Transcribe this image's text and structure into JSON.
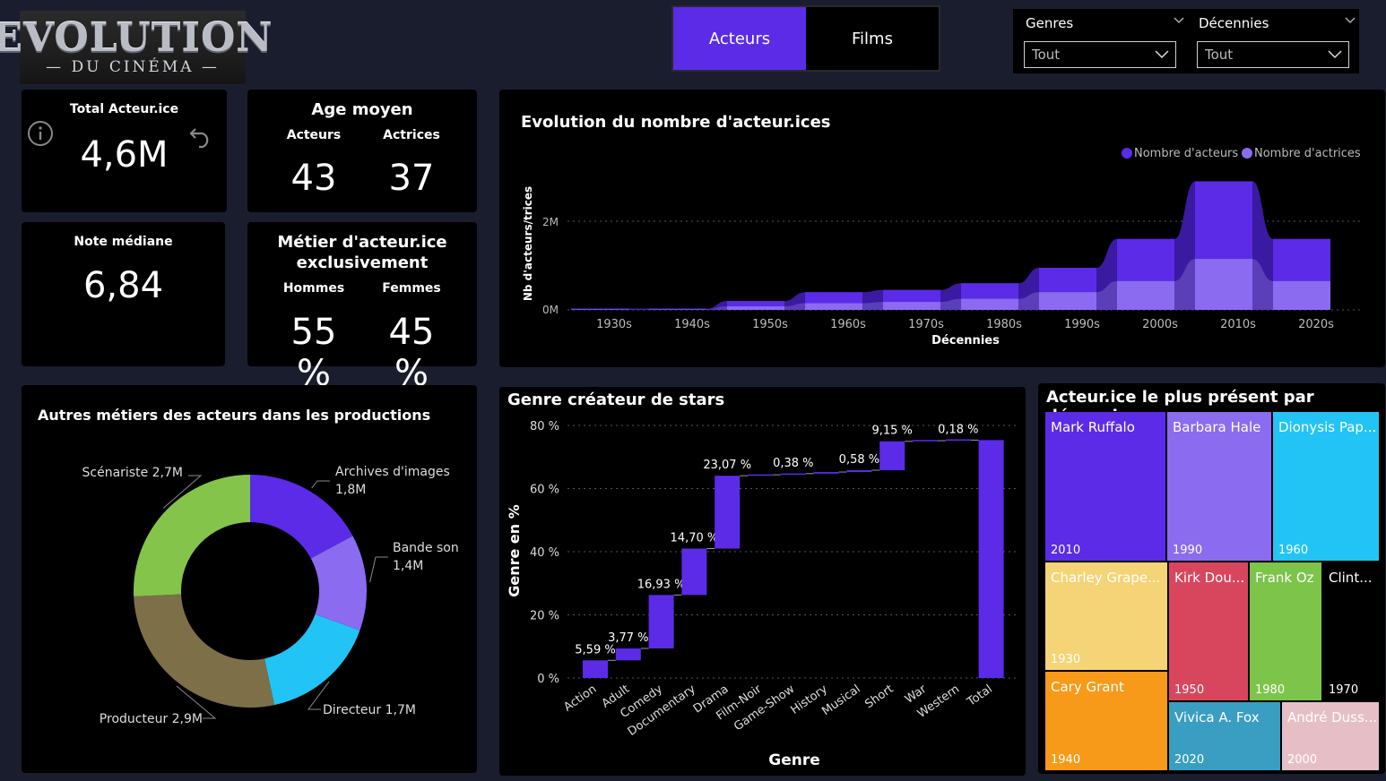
{
  "logo": {
    "main": "EVOLUTION",
    "sub": "— DU CINÉMA —"
  },
  "tabs": [
    {
      "label": "Acteurs",
      "active": true
    },
    {
      "label": "Films",
      "active": false
    }
  ],
  "filters": [
    {
      "label": "Genres",
      "value": "Tout"
    },
    {
      "label": "Décennies",
      "value": "Tout"
    }
  ],
  "kpis": {
    "total": {
      "title": "Total Acteur.ice",
      "value": "4,6M"
    },
    "age": {
      "title": "Age moyen",
      "acteurs_label": "Acteurs",
      "actrices_label": "Actrices",
      "acteurs": "43",
      "actrices": "37"
    },
    "note": {
      "title": "Note médiane",
      "value": "6,84"
    },
    "metier": {
      "title_line1": "Métier d'acteur.ice",
      "title_line2": "exclusivement",
      "hommes_label": "Hommes",
      "femmes_label": "Femmes",
      "hommes": "55 %",
      "femmes": "45 %"
    }
  },
  "colors": {
    "accent": "#5b2be8",
    "accent_light": "#8b6bf0",
    "purple_mid": "#4a22c8"
  },
  "evolution_chart": {
    "title": "Evolution du nombre d'acteur.ices",
    "legend": [
      "Nombre d'acteurs",
      "Nombre d'actrices"
    ],
    "ylabel": "Nb d'acteurs/trices",
    "xlabel": "Décennies",
    "yticks": [
      "2M",
      "0M"
    ]
  },
  "donut_chart": {
    "title": "Autres métiers des acteurs dans les productions"
  },
  "waterfall_chart": {
    "title": "Genre créateur de stars",
    "ylabel": "Genre en %",
    "xlabel": "Genre",
    "yticks": [
      "80 %",
      "60 %",
      "40 %",
      "20 %",
      "0 %"
    ]
  },
  "treemap": {
    "title": "Acteur.ice le plus présent par décennie",
    "cells": [
      {
        "name": "Mark Ruffalo",
        "year": "2010",
        "color": "#5b2be8"
      },
      {
        "name": "Barbara Hale",
        "year": "1990",
        "color": "#8b6bf0"
      },
      {
        "name": "Dionysis Pap...",
        "year": "1960",
        "color": "#22c4f5"
      },
      {
        "name": "Charley Grape...",
        "year": "1930",
        "color": "#f5d477"
      },
      {
        "name": "Kirk Dou...",
        "year": "1950",
        "color": "#d8465e"
      },
      {
        "name": "Frank Oz",
        "year": "1980",
        "color": "#7cc44a"
      },
      {
        "name": "Clint...",
        "year": "1970",
        "color": "#000000"
      },
      {
        "name": "Cary Grant",
        "year": "1940",
        "color": "#f79a1a"
      },
      {
        "name": "Vivica A. Fox",
        "year": "2020",
        "color": "#3a9ec2"
      },
      {
        "name": "André Duss...",
        "year": "2000",
        "color": "#e6bfc6"
      }
    ]
  },
  "chart_data": [
    {
      "type": "area",
      "title": "Evolution du nombre d'acteur.ices",
      "xlabel": "Décennies",
      "ylabel": "Nb d'acteurs/trices",
      "categories": [
        "1930s",
        "1940s",
        "1950s",
        "1960s",
        "1970s",
        "1980s",
        "1990s",
        "2000s",
        "2010s",
        "2020s"
      ],
      "ylim": [
        0,
        2.5
      ],
      "series": [
        {
          "name": "Nombre d'acteurs",
          "values": [
            0.03,
            0.03,
            0.2,
            0.4,
            0.45,
            0.6,
            0.95,
            1.6,
            2.9,
            1.6
          ]
        },
        {
          "name": "Nombre d'actrices",
          "values": [
            0.01,
            0.01,
            0.08,
            0.15,
            0.18,
            0.25,
            0.4,
            0.65,
            1.15,
            0.65
          ]
        }
      ],
      "legend_position": "top-right",
      "grid": true
    },
    {
      "type": "pie",
      "title": "Autres métiers des acteurs dans les productions",
      "labels": [
        "Archives d'images",
        "Bande son",
        "Directeur",
        "Producteur",
        "Scénariste"
      ],
      "value_labels": [
        "1,8M",
        "1,4M",
        "1,7M",
        "2,9M",
        "2,7M"
      ],
      "values": [
        1.8,
        1.4,
        1.7,
        2.9,
        2.7
      ],
      "colors": [
        "#5b2be8",
        "#8b6bf0",
        "#22c4f5",
        "#7d7048",
        "#84c44a"
      ],
      "hole": 0.5
    },
    {
      "type": "bar",
      "subtype": "waterfall",
      "title": "Genre créateur de stars",
      "xlabel": "Genre",
      "ylabel": "Genre en %",
      "categories": [
        "Action",
        "Adult",
        "Comedy",
        "Documentary",
        "Drama",
        "Film-Noir",
        "Game-Show",
        "History",
        "Musical",
        "Short",
        "War",
        "Western",
        "Total"
      ],
      "values": [
        5.59,
        3.77,
        16.93,
        14.7,
        23.07,
        0.3,
        0.38,
        0.5,
        0.58,
        9.15,
        0.2,
        0.18,
        75.35
      ],
      "labels": [
        "5,59 %",
        "3,77 %",
        "16,93 %",
        "14,70 %",
        "23,07 %",
        "",
        "0,38 %",
        "",
        "0,58 %",
        "9,15 %",
        "",
        "0,18 %",
        ""
      ],
      "ylim": [
        0,
        80
      ],
      "grid": true
    }
  ]
}
